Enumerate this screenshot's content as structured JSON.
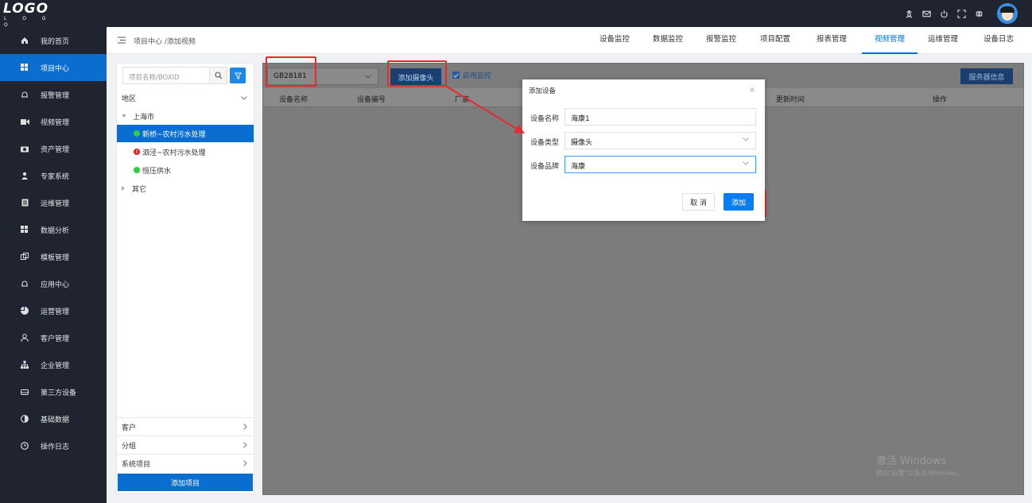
{
  "brand": {
    "logo": "LOGO",
    "logo_sub": "L O G O"
  },
  "topbar": {
    "icons": [
      "user-hat-icon",
      "mail-icon",
      "power-icon",
      "fullscreen-icon",
      "globe-icon",
      "avatar"
    ]
  },
  "sidebar": {
    "items": [
      {
        "label": "我的首页",
        "icon": "home-icon"
      },
      {
        "label": "项目中心",
        "icon": "grid-icon",
        "active": true
      },
      {
        "label": "报警管理",
        "icon": "bell-icon"
      },
      {
        "label": "视频管理",
        "icon": "video-icon"
      },
      {
        "label": "资产管理",
        "icon": "camera-icon"
      },
      {
        "label": "专家系统",
        "icon": "person-icon"
      },
      {
        "label": "运维管理",
        "icon": "document-icon"
      },
      {
        "label": "数据分析",
        "icon": "grid-icon"
      },
      {
        "label": "模板管理",
        "icon": "template-icon"
      },
      {
        "label": "应用中心",
        "icon": "bell-icon"
      },
      {
        "label": "运营管理",
        "icon": "pie-icon"
      },
      {
        "label": "客户管理",
        "icon": "customer-icon"
      },
      {
        "label": "企业管理",
        "icon": "org-icon"
      },
      {
        "label": "第三方设备",
        "icon": "device-icon"
      },
      {
        "label": "基础数据",
        "icon": "half-circle-icon"
      },
      {
        "label": "操作日志",
        "icon": "clock-icon"
      }
    ]
  },
  "header": {
    "breadcrumb": "项目中心 /添加视频",
    "nav": [
      {
        "label": "设备监控"
      },
      {
        "label": "数据监控"
      },
      {
        "label": "报警监控"
      },
      {
        "label": "项目配置"
      },
      {
        "label": "报表管理"
      },
      {
        "label": "视频管理",
        "active": true
      },
      {
        "label": "运维管理"
      },
      {
        "label": "设备日志"
      }
    ]
  },
  "tree": {
    "search_placeholder": "项目名称/BOXID",
    "region_label": "地区",
    "city": "上海市",
    "projects": [
      {
        "name": "新桥~农村污水处理",
        "status": "online",
        "selected": true
      },
      {
        "name": "泗泾~农村污水处理",
        "status": "alarm"
      },
      {
        "name": "恒压供水",
        "status": "online"
      }
    ],
    "other": "其它",
    "groups": [
      "客户",
      "分组",
      "系统项目"
    ],
    "add_project": "添加项目"
  },
  "main": {
    "protocol_select": "GB28181",
    "add_camera": "添加摄像头",
    "enable_monitor": "启用监控",
    "server_info": "服务器信息",
    "columns": [
      "设备名称",
      "设备编号",
      "厂家",
      "更新时间",
      "操作"
    ]
  },
  "dialog": {
    "title": "添加设备",
    "fields": [
      {
        "label": "设备名称",
        "value": "海康1"
      },
      {
        "label": "设备类型",
        "value": "摄像头"
      },
      {
        "label": "设备品牌",
        "value": "海康"
      }
    ],
    "cancel": "取 消",
    "confirm": "添加"
  },
  "watermark": {
    "line1": "激活 Windows",
    "line2": "转到\"设置\"以激活 Windows。"
  },
  "colors": {
    "accent": "#0a6ed1",
    "sidebar_bg": "#1f2430",
    "annotation": "#e52b2b",
    "online": "#2ecc40",
    "alarm": "#e02020"
  }
}
